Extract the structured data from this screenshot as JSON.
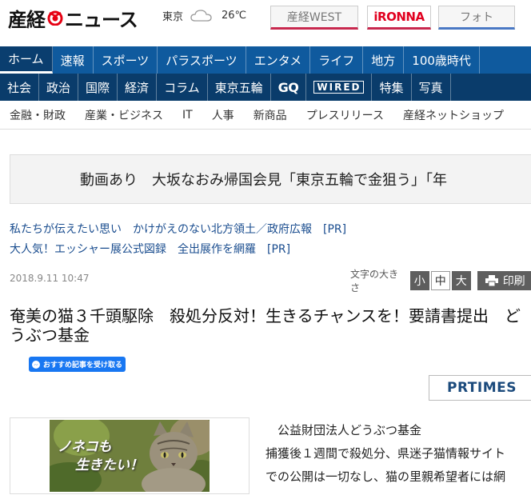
{
  "header": {
    "logo_text1": "産経",
    "logo_text2": "ニュース",
    "weather_city": "東京",
    "weather_icon": "cloud-icon",
    "weather_temp": "26℃",
    "links": {
      "west": "産経WEST",
      "ironna": "iRONNA",
      "foto": "フォト"
    }
  },
  "nav_primary": [
    "ホーム",
    "速報",
    "スポーツ",
    "パラスポーツ",
    "エンタメ",
    "ライフ",
    "地方",
    "100歳時代"
  ],
  "nav_secondary": [
    "社会",
    "政治",
    "国際",
    "経済",
    "コラム",
    "東京五輪",
    "GQ",
    "WIRED",
    "特集",
    "写真"
  ],
  "nav_tertiary": [
    "金融・財政",
    "産業・ビジネス",
    "IT",
    "人事",
    "新商品",
    "プレスリリース",
    "産経ネットショップ"
  ],
  "banner": {
    "text": "動画あり　大坂なおみ帰国会見「東京五輪で金狙う」「年"
  },
  "pr_links": [
    "私たちが伝えたい思い　かけがえのない北方領土／政府広報　[PR]",
    "大人気！エッシャー展公式図録　全出展作を網羅　[PR]"
  ],
  "article": {
    "date": "2018.9.11 10:47",
    "font_size_label": "文字の大きさ",
    "font_sizes": [
      "小",
      "中",
      "大"
    ],
    "print_label": "印刷",
    "headline": "奄美の猫３千頭駆除　殺処分反対！生きるチャンスを！要請書提出　どうぶつ基金",
    "fb_button": "おすすめ記事を受け取る",
    "prtimes": "PRTIMES",
    "image_caption_line1": "ノネコも",
    "image_caption_line2": "生きたい！",
    "body_lines": [
      "　公益財団法人どうぶつ基金",
      "捕獲後１週間で殺処分、県迷子猫情報サイト",
      "での公開は一切なし、猫の里親希望者には網"
    ]
  },
  "colors": {
    "nav_primary_bg": "#0f5a9e",
    "nav_secondary_bg": "#0a3c6b",
    "link_blue": "#1a4d8f",
    "accent_red": "#c8284e"
  }
}
